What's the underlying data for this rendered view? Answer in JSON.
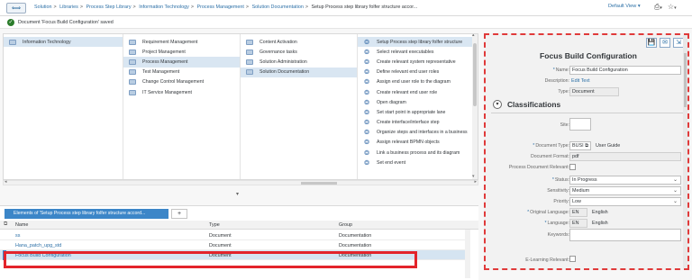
{
  "topbar": {
    "back_glyph": "⟺",
    "breadcrumb": [
      {
        "label": "Solution"
      },
      {
        "label": "Libraries"
      },
      {
        "label": "Process Step Library"
      },
      {
        "label": "Information Technology"
      },
      {
        "label": "Process Management"
      },
      {
        "label": "Solution Documentation"
      }
    ],
    "current": "Setup  Process step library folfer structure accor...",
    "separator": ">",
    "default_view": "Default View",
    "view_caret": "▾",
    "icon_glyph_1": "⎙",
    "icon_glyph_2": "☆",
    "icon_caret": "▾"
  },
  "message": {
    "icon_glyph": "✓",
    "text": "Document 'Focus Build Configuration' saved"
  },
  "columns": {
    "col1": [
      "Information Technology"
    ],
    "col1_selected": 0,
    "col2": [
      "Requirement Management",
      "Project Management",
      "Process Management",
      "Test Management",
      "Change Control Management",
      "IT Service Management"
    ],
    "col2_selected": 2,
    "col3": [
      "Content Activation",
      "Governance tasks",
      "Solution Administration",
      "Solution Documentation"
    ],
    "col3_selected": 3,
    "col4": [
      "Setup  Process step library folfer structure",
      "Select relevant executables",
      "Create relevant system representative",
      "Define relevant end user roles",
      "Assign end user role to the diagram",
      "Create relevant end user role",
      "Open diagram",
      "Set start point in appropriate lane",
      "Create interface/interface step",
      "Organize steps and interfaces in a business",
      "Assign relevant BPMN objects",
      "Link a business process and its diagram",
      "Set end event"
    ],
    "col4_selected": 0,
    "col4_glyph": "❂"
  },
  "scroll": {
    "left_arrow": "◂",
    "right_arrow": "▸",
    "up_arrow": "▴",
    "down_arrow": "▾"
  },
  "splitter_glyph": "▾",
  "elements": {
    "tab_label": "Elements of 'Setup Process step library folfer structure accord...",
    "add_label": "+",
    "corner_glyph": "⧉",
    "headers": {
      "name": "Name",
      "type": "Type",
      "group": "Group"
    },
    "rows": [
      {
        "name": "ss",
        "type": "Document",
        "group": "Documentation"
      },
      {
        "name": "Hana_patch_upg_std",
        "type": "Document",
        "group": "Documentation"
      },
      {
        "name": "Focus Build Configuration",
        "type": "Document",
        "group": "Documentation"
      }
    ],
    "selected_row": 2
  },
  "panel": {
    "title": "Focus Build Configuration",
    "tools": [
      "💾",
      "✉",
      "⇲"
    ],
    "required_glyph": "*",
    "name_label": "Name:",
    "name_value": "Focus Build Configuration",
    "description_label": "Description:",
    "description_value": "Edit Text",
    "type_label": "Type:",
    "type_value": "Document",
    "collapse_glyph": "▾",
    "classifications_title": "Classifications",
    "site_label": "Site:",
    "site_value": "",
    "doc_type_label": "Document Type:",
    "doc_type_code": "BUSI",
    "doc_type_open": "⧉",
    "doc_type_value": "User Guide",
    "doc_format_label": "Document Format:",
    "doc_format_value": "pdf",
    "process_relevant_label": "Process Document Relevant:",
    "status_label": "Status:",
    "status_value": "In Progress",
    "sensitivity_label": "Sensitivity:",
    "sensitivity_value": "Medium",
    "priority_label": "Priority:",
    "priority_value": "Low",
    "orig_lang_label": "Original Language:",
    "orig_lang_code": "EN",
    "orig_lang_value": "English",
    "lang_label": "Language:",
    "lang_code": "EN",
    "lang_value": "English",
    "keywords_label": "Keywords:",
    "keywords_value": "",
    "elearning_label": "E-Learning Relevant:",
    "dropdown_caret": "⌄"
  },
  "colors": {
    "link": "#2b6fa6",
    "selection": "#d9e6f2",
    "tab_blue": "#3c86c8",
    "highlight_red": "#e3242b",
    "saved_green": "#2b7c2b"
  }
}
